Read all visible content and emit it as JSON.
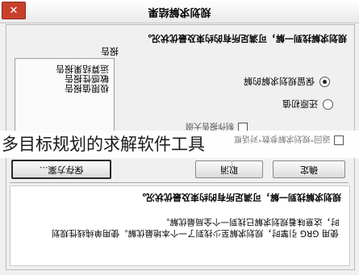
{
  "window": {
    "title": "规划求解结果",
    "close_glyph": "✕"
  },
  "main": {
    "message": "规划求解找到一解，可满足所有的约束及最优状况。",
    "report_label": "报告",
    "reports": [
      "运算结果报告",
      "敏感性报告",
      "极限值报告"
    ],
    "options": [
      {
        "label": "保留规划求解的解",
        "selected": true
      },
      {
        "label": "还原初值",
        "selected": false
      }
    ],
    "back_checkbox_label": "返回\"规划求解参数\"对话框",
    "outline_checkbox_label": "制作报告大纲"
  },
  "overlay_caption": "多目标规划的求解软件工具",
  "buttons": {
    "ok": "确定",
    "cancel": "取消",
    "save_scenario": "保存方案..."
  },
  "description": {
    "title": "规划求解找到一解，可满足所有的约束及最优状况。",
    "body_line1": "使用 GRG 引擎时，规划求解至少找到了一个本地最优解。使用单纯线性规划",
    "body_line2": "时，这意味着规划求解已找到一个全局最优解。"
  }
}
